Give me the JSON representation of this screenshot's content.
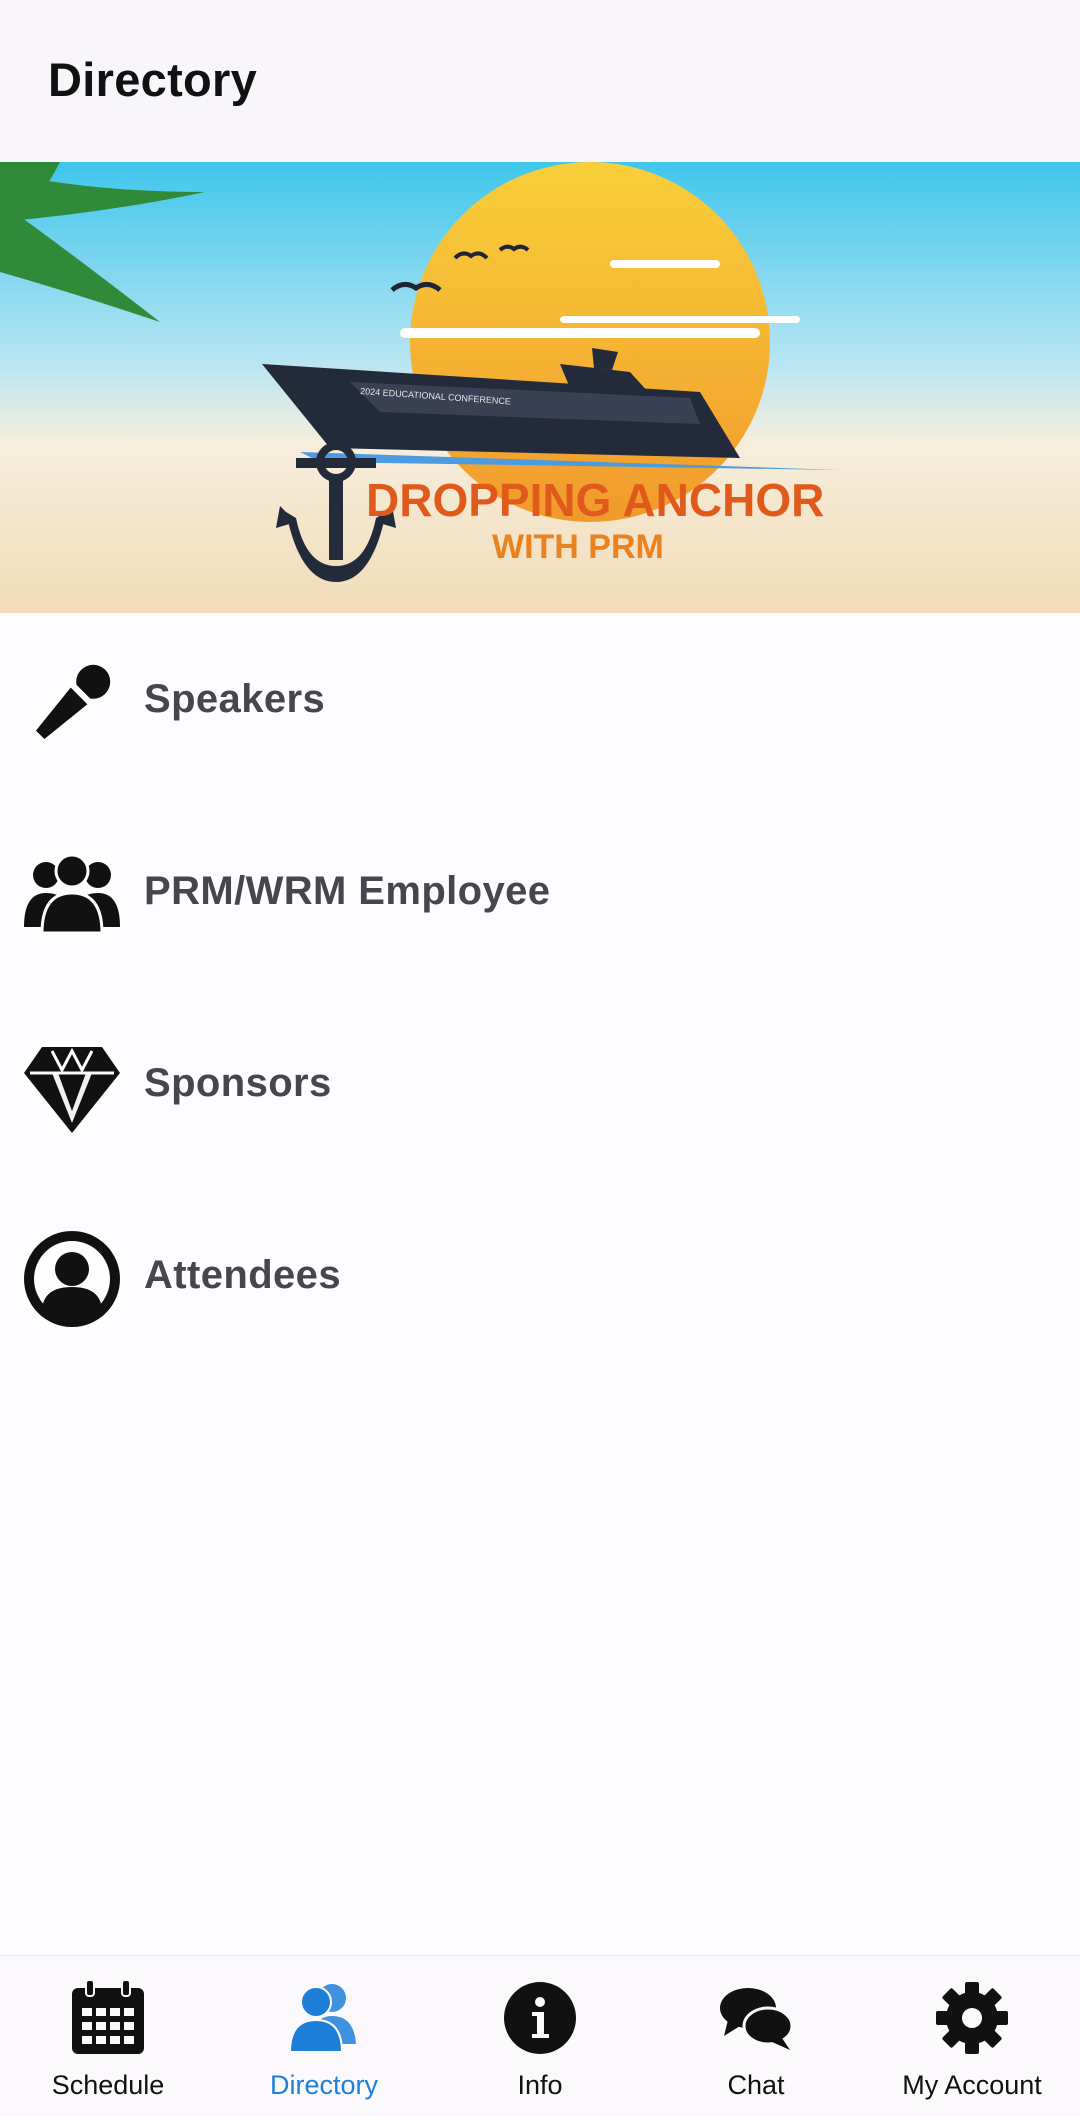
{
  "header": {
    "title": "Directory"
  },
  "banner": {
    "ship_subtitle": "2024 EDUCATIONAL CONFERENCE",
    "headline_line1": "DROPPING ANCHOR",
    "headline_line2": "WITH PRM"
  },
  "menu": {
    "items": [
      {
        "label": "Speakers",
        "icon": "microphone-icon"
      },
      {
        "label": "PRM/WRM Employee",
        "icon": "group-icon"
      },
      {
        "label": "Sponsors",
        "icon": "diamond-icon"
      },
      {
        "label": "Attendees",
        "icon": "person-circle-icon"
      }
    ]
  },
  "bottom_nav": {
    "active_index": 1,
    "active_color": "#1e7fd8",
    "items": [
      {
        "label": "Schedule",
        "icon": "calendar-icon"
      },
      {
        "label": "Directory",
        "icon": "users-icon"
      },
      {
        "label": "Info",
        "icon": "info-icon"
      },
      {
        "label": "Chat",
        "icon": "chat-icon"
      },
      {
        "label": "My Account",
        "icon": "gear-icon"
      }
    ]
  }
}
